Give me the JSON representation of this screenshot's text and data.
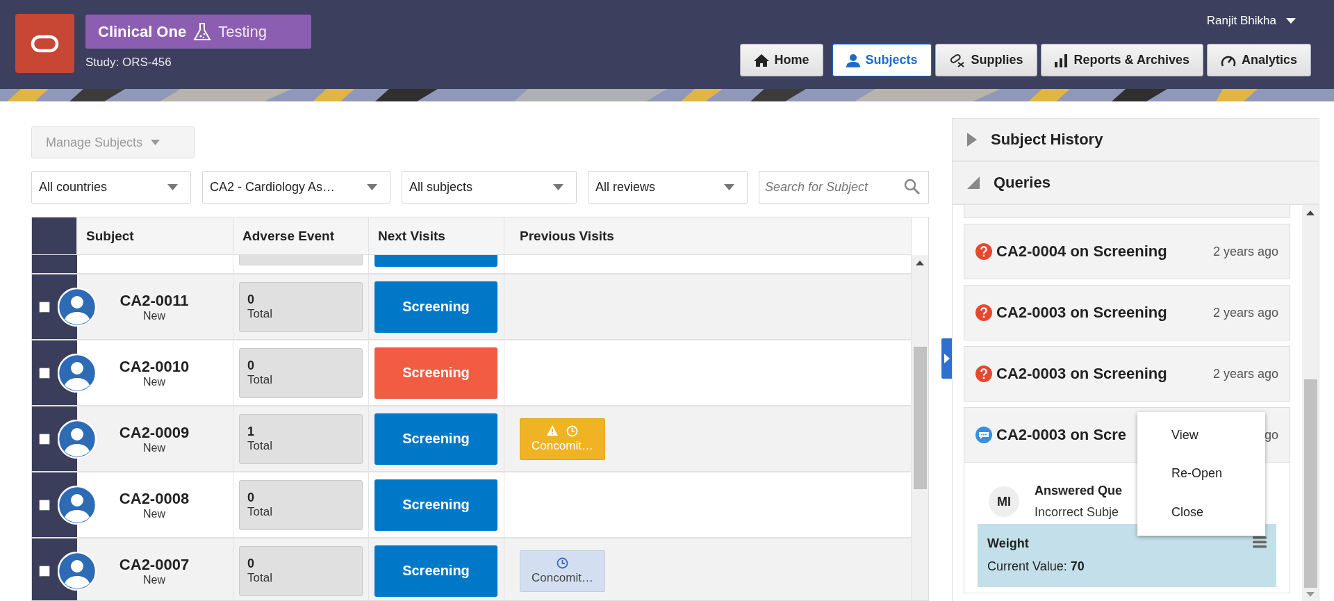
{
  "header": {
    "product": "Clinical One",
    "environment": "Testing",
    "study": "Study: ORS-456",
    "user": "Ranjit Bhikha"
  },
  "nav": [
    {
      "kind": "home",
      "label": "Home",
      "selected": false
    },
    {
      "kind": "subjects",
      "label": "Subjects",
      "selected": true
    },
    {
      "kind": "supplies",
      "label": "Supplies",
      "selected": false
    },
    {
      "kind": "reports",
      "label": "Reports & Archives",
      "selected": false
    },
    {
      "kind": "analytics",
      "label": "Analytics",
      "selected": false
    }
  ],
  "manage_button": {
    "label": "Manage Subjects",
    "disabled": true
  },
  "filters": [
    {
      "value": "All countries"
    },
    {
      "value": "CA2 - Cardiology As…"
    },
    {
      "value": "All subjects"
    },
    {
      "value": "All reviews"
    }
  ],
  "search": {
    "placeholder": "Search for Subject"
  },
  "table": {
    "columns": [
      "Subject",
      "Adverse Event",
      "Next Visits",
      "Previous Visits"
    ],
    "rows": [
      {
        "subject": "CA2-0011",
        "status": "New",
        "checked": false,
        "adverse_count": "0",
        "adverse_label": "Total",
        "next_visit": {
          "label": "Screening",
          "color": "#0078c8"
        },
        "previous_visits": []
      },
      {
        "subject": "CA2-0010",
        "status": "New",
        "checked": false,
        "adverse_count": "0",
        "adverse_label": "Total",
        "next_visit": {
          "label": "Screening",
          "color": "#f25c43"
        },
        "previous_visits": []
      },
      {
        "subject": "CA2-0009",
        "status": "New",
        "checked": false,
        "adverse_count": "1",
        "adverse_label": "Total",
        "next_visit": {
          "label": "Screening",
          "color": "#0078c8"
        },
        "previous_visits": [
          {
            "kind": "warning",
            "label": "Concomit…"
          }
        ]
      },
      {
        "subject": "CA2-0008",
        "status": "New",
        "checked": false,
        "adverse_count": "0",
        "adverse_label": "Total",
        "next_visit": {
          "label": "Screening",
          "color": "#0078c8"
        },
        "previous_visits": []
      },
      {
        "subject": "CA2-0007",
        "status": "New",
        "checked": false,
        "adverse_count": "0",
        "adverse_label": "Total",
        "next_visit": {
          "label": "Screening",
          "color": "#0078c8"
        },
        "previous_visits": [
          {
            "kind": "pending",
            "label": "Concomit…"
          }
        ]
      }
    ]
  },
  "side_sections": [
    {
      "title": "Subject History",
      "expanded": false
    },
    {
      "title": "Queries",
      "expanded": true
    }
  ],
  "queries": [
    {
      "kind": "open",
      "title": "CA2-0004 on Screening",
      "time": "2 years ago",
      "expanded": false
    },
    {
      "kind": "open",
      "title": "CA2-0003 on Screening",
      "time": "2 years ago",
      "expanded": false
    },
    {
      "kind": "open",
      "title": "CA2-0003 on Screening",
      "time": "2 years ago",
      "expanded": false
    },
    {
      "kind": "answered",
      "title": "CA2-0003 on Scre",
      "time": "go",
      "expanded": true,
      "detail": {
        "initials": "MI",
        "status": "Answered Que",
        "reason": "Incorrect Subje",
        "item_name": "Weight",
        "item_value": "Current Value: **70**"
      }
    }
  ],
  "context_menu": [
    "View",
    "Re-Open",
    "Close"
  ]
}
